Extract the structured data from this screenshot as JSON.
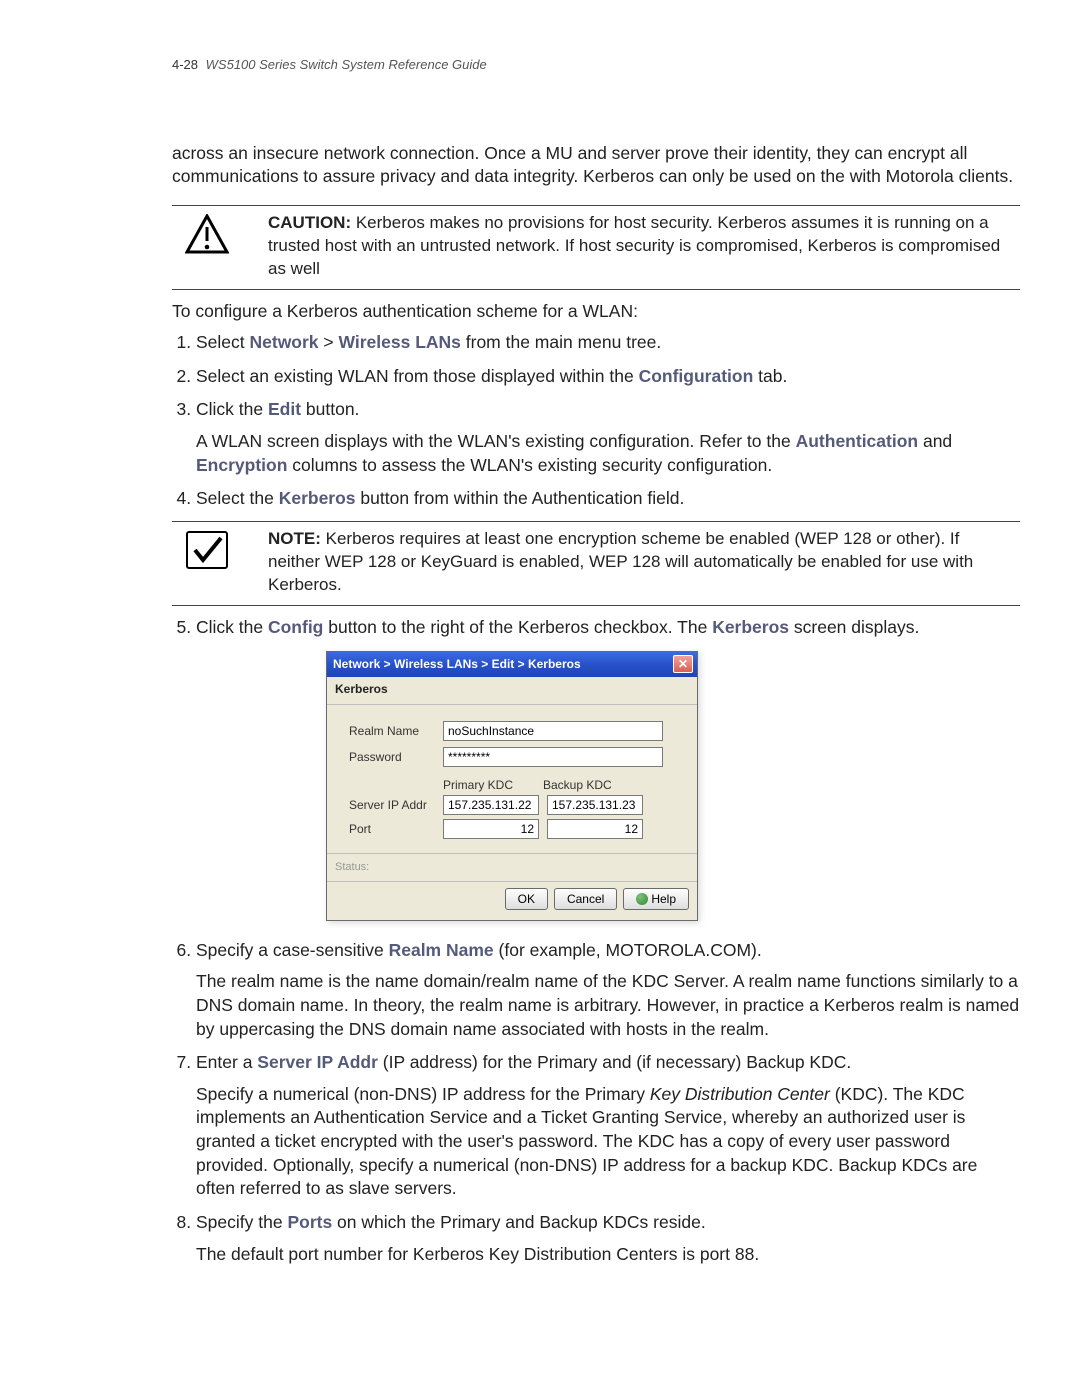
{
  "header": {
    "page_num": "4-28",
    "doc_title": "WS5100 Series Switch System Reference Guide"
  },
  "intro_para": "across an insecure network connection. Once a MU and server prove their identity, they can encrypt all communications to assure privacy and data integrity. Kerberos can only be used on the with Motorola clients.",
  "caution": {
    "label": "CAUTION:",
    "text": "Kerberos makes no provisions for host security. Kerberos assumes it is running on a trusted host with an untrusted network. If host security is compromised, Kerberos is compromised as well"
  },
  "lead_in": "To configure a Kerberos authentication scheme for a WLAN:",
  "steps": {
    "s1": {
      "a": "Select ",
      "b": "Network",
      "gt": " > ",
      "c": "Wireless LANs",
      "d": " from the main menu tree."
    },
    "s2": {
      "a": "Select an existing WLAN from those displayed within the ",
      "b": "Configuration",
      "c": " tab."
    },
    "s3": {
      "a": "Click the ",
      "b": "Edit",
      "c": " button."
    },
    "s3sub": {
      "a": "A WLAN screen displays with the WLAN's existing configuration. Refer to the ",
      "b": "Authentication",
      "c": " and ",
      "d": "Encryption",
      "e": " columns to assess the WLAN's existing security configuration."
    },
    "s4": {
      "a": "Select the ",
      "b": "Kerberos",
      "c": " button from within the Authentication field."
    }
  },
  "note": {
    "label": "NOTE:",
    "text": "Kerberos requires at least one encryption scheme be enabled (WEP 128 or other). If neither WEP 128 or KeyGuard is enabled, WEP 128 will automatically be enabled for use with Kerberos."
  },
  "s5": {
    "a": "Click the ",
    "b": "Config",
    "c": " button to the right of the Kerberos checkbox. The ",
    "d": "Kerberos",
    "e": " screen displays."
  },
  "dialog": {
    "title": "Network > Wireless LANs > Edit > Kerberos",
    "section": "Kerberos",
    "labels": {
      "realm": "Realm Name",
      "password": "Password",
      "primary_kdc": "Primary KDC",
      "backup_kdc": "Backup KDC",
      "server_ip": "Server IP Addr",
      "port": "Port"
    },
    "values": {
      "realm": "noSuchInstance",
      "password": "*********",
      "server_ip_primary": "157.235.131.22",
      "server_ip_backup": "157.235.131.23",
      "port_primary": "12",
      "port_backup": "12"
    },
    "status_label": "Status:",
    "buttons": {
      "ok": "OK",
      "cancel": "Cancel",
      "help": "Help"
    }
  },
  "s6": {
    "a": "Specify a case-sensitive ",
    "b": "Realm Name",
    "c": " (for example, MOTOROLA.COM).",
    "sub": "The realm name is the name domain/realm name of the KDC Server. A realm name functions similarly to a DNS domain name. In theory, the realm name is arbitrary. However, in practice a Kerberos realm is named by uppercasing the DNS domain name associated with hosts in the realm."
  },
  "s7": {
    "a": "Enter a ",
    "b": "Server IP Addr",
    "c": " (IP address) for the Primary and (if necessary) Backup KDC.",
    "sub_a": "Specify a numerical (non-DNS) IP address for the Primary ",
    "sub_b": "Key Distribution Center",
    "sub_c": " (KDC). The KDC implements an Authentication Service and a Ticket Granting Service, whereby an authorized user is granted a ticket encrypted with the user's password. The KDC has a copy of every user password provided. Optionally, specify a numerical (non-DNS) IP address for a backup KDC. Backup KDCs are often referred to as slave servers."
  },
  "s8": {
    "a": "Specify the ",
    "b": "Ports",
    "c": " on which the Primary and Backup KDCs reside.",
    "sub": "The default port number for Kerberos Key Distribution Centers is port 88."
  }
}
